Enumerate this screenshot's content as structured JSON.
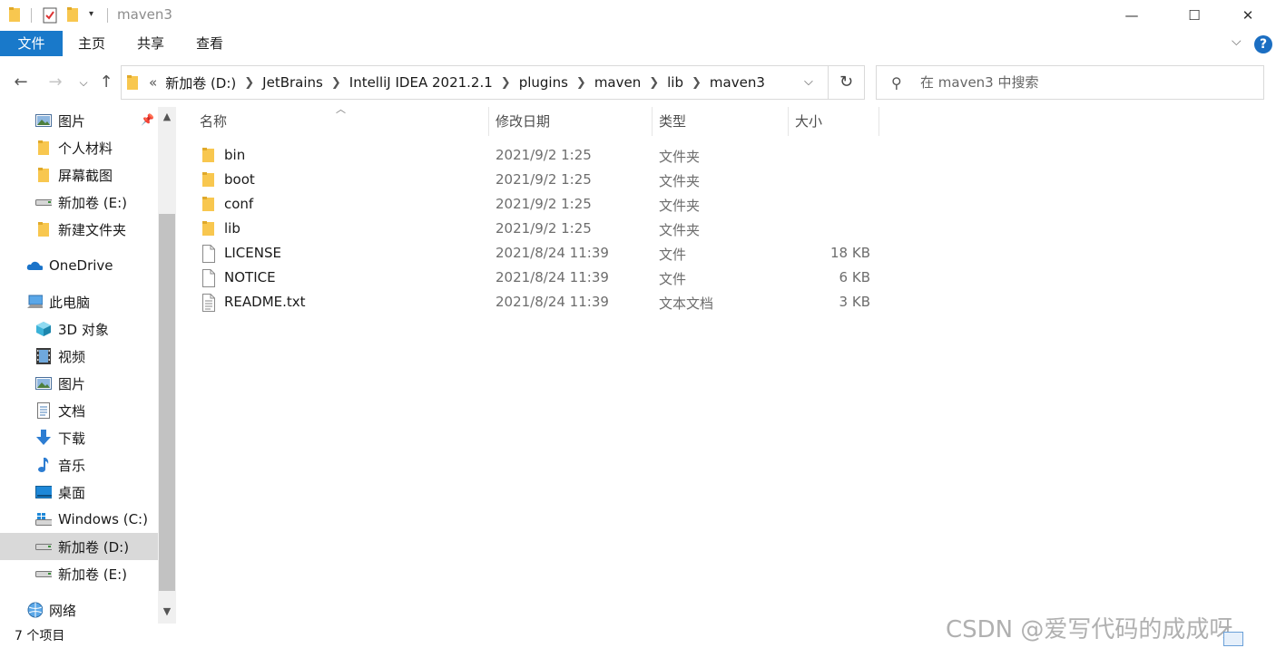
{
  "window": {
    "title": "maven3",
    "minimize_glyph": "—",
    "maximize_glyph": "☐",
    "close_glyph": "✕"
  },
  "ribbon": {
    "tabs": [
      "文件",
      "主页",
      "共享",
      "查看"
    ],
    "help_glyph": "?",
    "collapse_glyph": "⌵"
  },
  "address": {
    "overflow": "«",
    "breadcrumbs": [
      "新加卷 (D:)",
      "JetBrains",
      "IntelliJ IDEA 2021.2.1",
      "plugins",
      "maven",
      "lib",
      "maven3"
    ]
  },
  "search": {
    "placeholder": "在 maven3 中搜索"
  },
  "sidebar": {
    "items": [
      {
        "label": "图片",
        "icon": "pictures-icon",
        "pinned": true
      },
      {
        "label": "个人材料",
        "icon": "folder-icon"
      },
      {
        "label": "屏幕截图",
        "icon": "folder-icon"
      },
      {
        "label": "新加卷 (E:)",
        "icon": "drive-icon"
      },
      {
        "label": "新建文件夹",
        "icon": "folder-icon"
      },
      {
        "label": "OneDrive",
        "icon": "onedrive-icon"
      },
      {
        "label": "此电脑",
        "icon": "this-pc-icon"
      },
      {
        "label": "3D 对象",
        "icon": "3d-objects-icon"
      },
      {
        "label": "视频",
        "icon": "videos-icon"
      },
      {
        "label": "图片",
        "icon": "pictures-icon"
      },
      {
        "label": "文档",
        "icon": "documents-icon"
      },
      {
        "label": "下载",
        "icon": "downloads-icon"
      },
      {
        "label": "音乐",
        "icon": "music-icon"
      },
      {
        "label": "桌面",
        "icon": "desktop-icon"
      },
      {
        "label": "Windows (C:)",
        "icon": "windows-drive-icon"
      },
      {
        "label": "新加卷 (D:)",
        "icon": "drive-icon",
        "selected": true
      },
      {
        "label": "新加卷 (E:)",
        "icon": "drive-icon"
      },
      {
        "label": "网络",
        "icon": "network-icon"
      }
    ]
  },
  "columns": {
    "name": "名称",
    "date": "修改日期",
    "type": "类型",
    "size": "大小"
  },
  "files": [
    {
      "name": "bin",
      "date": "2021/9/2 1:25",
      "type": "文件夹",
      "size": "",
      "icon": "folder-icon"
    },
    {
      "name": "boot",
      "date": "2021/9/2 1:25",
      "type": "文件夹",
      "size": "",
      "icon": "folder-icon"
    },
    {
      "name": "conf",
      "date": "2021/9/2 1:25",
      "type": "文件夹",
      "size": "",
      "icon": "folder-icon"
    },
    {
      "name": "lib",
      "date": "2021/9/2 1:25",
      "type": "文件夹",
      "size": "",
      "icon": "folder-icon"
    },
    {
      "name": "LICENSE",
      "date": "2021/8/24 11:39",
      "type": "文件",
      "size": "18 KB",
      "icon": "file-icon"
    },
    {
      "name": "NOTICE",
      "date": "2021/8/24 11:39",
      "type": "文件",
      "size": "6 KB",
      "icon": "file-icon"
    },
    {
      "name": "README.txt",
      "date": "2021/8/24 11:39",
      "type": "文本文档",
      "size": "3 KB",
      "icon": "text-file-icon"
    }
  ],
  "status": {
    "count": "7 个项目"
  },
  "watermark": "CSDN @爱写代码的成成呀",
  "colors": {
    "accent": "#1979ca",
    "folder": "#f8c74f",
    "selection": "#d9d9d9"
  }
}
